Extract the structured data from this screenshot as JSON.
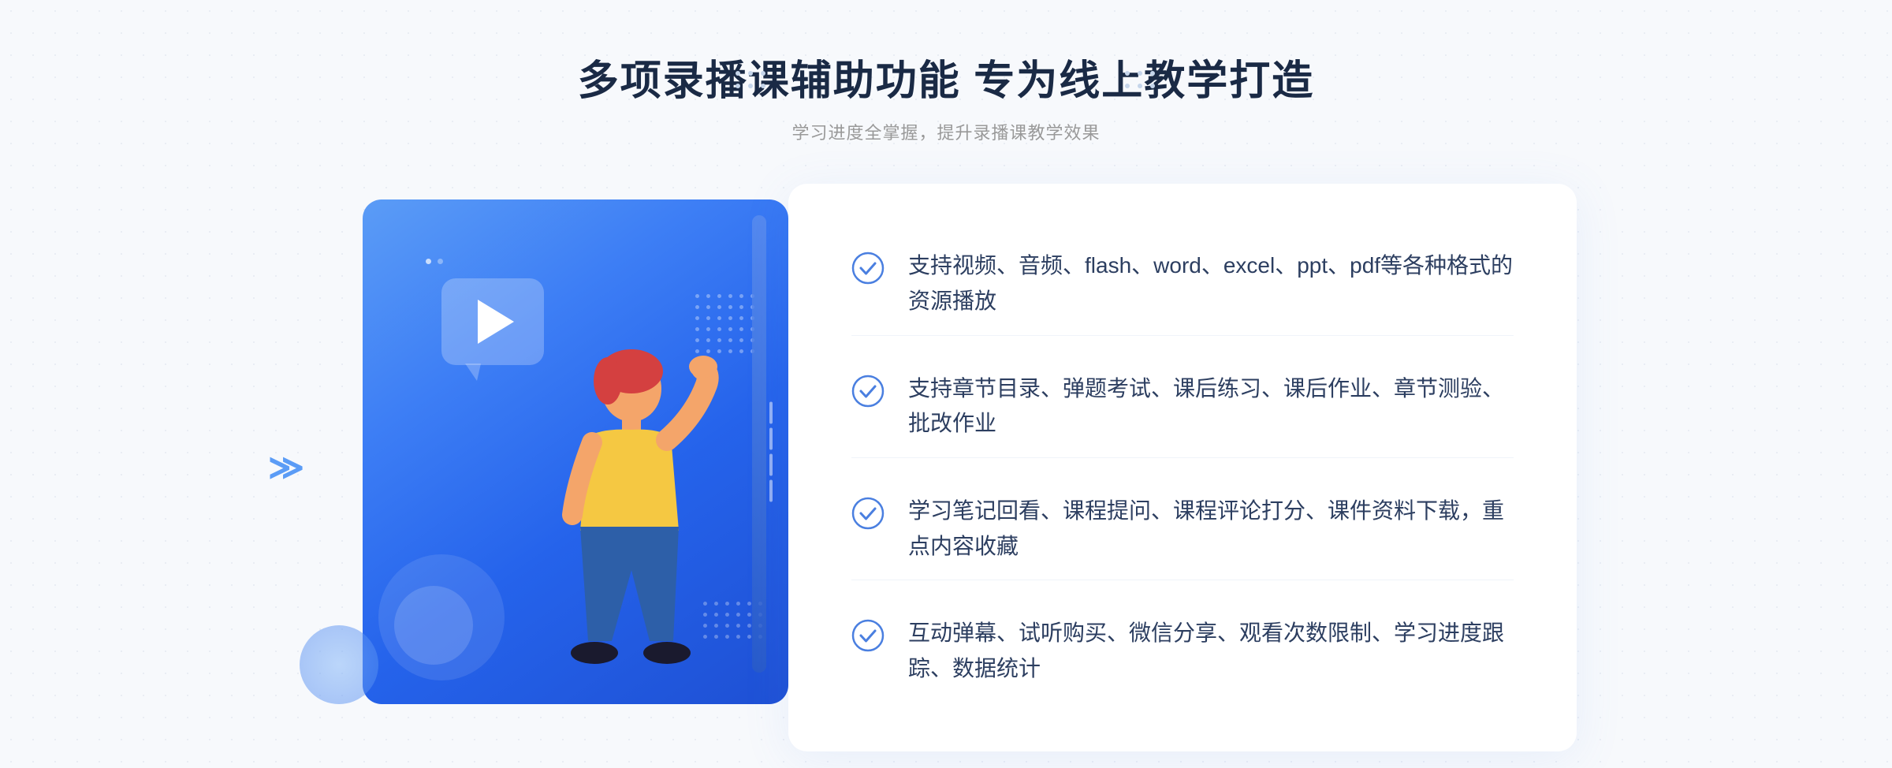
{
  "page": {
    "background": "#f7f9fc"
  },
  "header": {
    "title": "多项录播课辅助功能 专为线上教学打造",
    "subtitle": "学习进度全掌握，提升录播课教学效果"
  },
  "features": [
    {
      "id": 1,
      "text": "支持视频、音频、flash、word、excel、ppt、pdf等各种格式的资源播放"
    },
    {
      "id": 2,
      "text": "支持章节目录、弹题考试、课后练习、课后作业、章节测验、批改作业"
    },
    {
      "id": 3,
      "text": "学习笔记回看、课程提问、课程评论打分、课件资料下载，重点内容收藏"
    },
    {
      "id": 4,
      "text": "互动弹幕、试听购买、微信分享、观看次数限制、学习进度跟踪、数据统计"
    }
  ],
  "icons": {
    "check": "check-circle-icon",
    "play": "play-icon",
    "nav_left": "nav-left-chevron",
    "decorative_dots_left": "decorative-dots-left",
    "decorative_dots_right": "decorative-dots-right"
  },
  "colors": {
    "primary_blue": "#3d7ef5",
    "dark_blue": "#1a2a45",
    "text_gray": "#999999",
    "feature_text": "#2c3e60",
    "check_blue": "#4a7fe0",
    "accent_light": "#e8f0fe"
  }
}
